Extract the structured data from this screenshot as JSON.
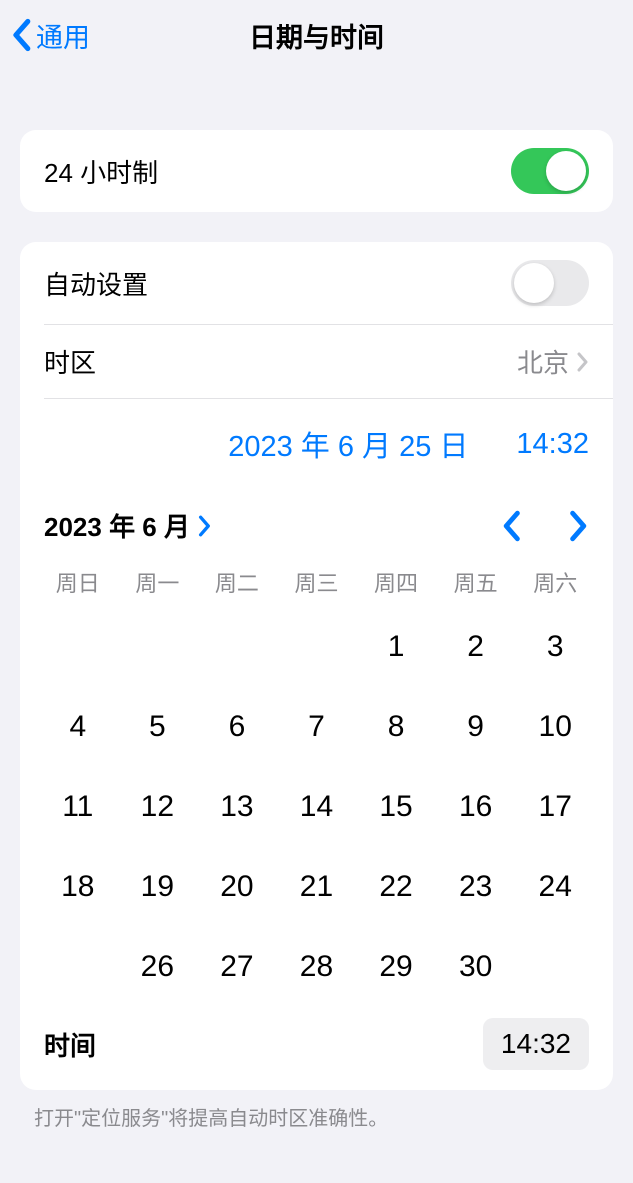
{
  "nav": {
    "back_label": "通用",
    "title": "日期与时间"
  },
  "twentyFourHour": {
    "label": "24 小时制",
    "enabled": true
  },
  "autoSet": {
    "label": "自动设置",
    "enabled": false
  },
  "timezone": {
    "label": "时区",
    "value": "北京"
  },
  "selectedDate": "2023 年 6 月 25 日",
  "selectedTime": "14:32",
  "calendar": {
    "monthLabel": "2023 年 6 月",
    "weekdays": [
      "周日",
      "周一",
      "周二",
      "周三",
      "周四",
      "周五",
      "周六"
    ],
    "leadingBlanks": 4,
    "daysInMonth": 30,
    "selectedDay": 25
  },
  "timeRow": {
    "label": "时间",
    "value": "14:32"
  },
  "footer": "打开\"定位服务\"将提高自动时区准确性。"
}
